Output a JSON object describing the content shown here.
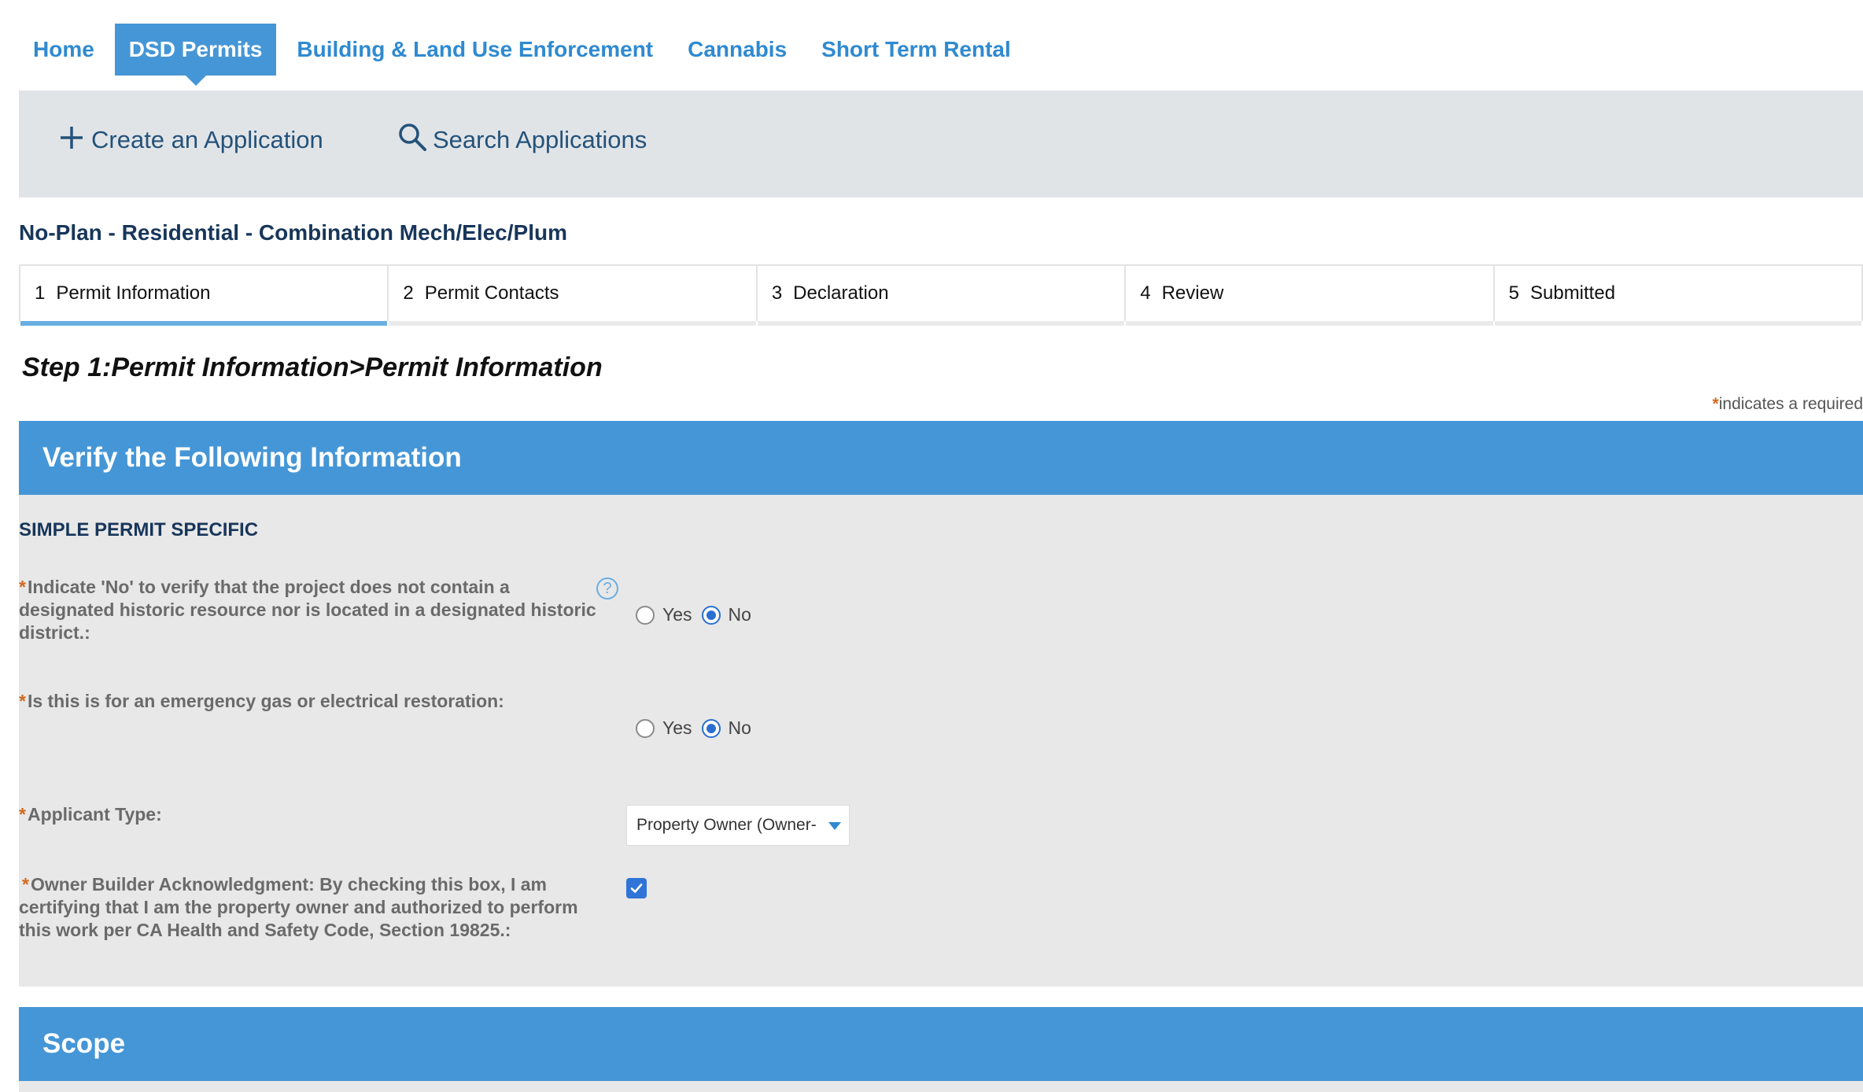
{
  "nav": {
    "tabs": [
      {
        "label": "Home",
        "active": false
      },
      {
        "label": "DSD Permits",
        "active": true
      },
      {
        "label": "Building & Land Use Enforcement",
        "active": false
      },
      {
        "label": "Cannabis",
        "active": false
      },
      {
        "label": "Short Term Rental",
        "active": false
      }
    ]
  },
  "actions": {
    "create": {
      "label": "Create an Application",
      "icon": "plus-icon"
    },
    "search": {
      "label": "Search Applications",
      "icon": "magnifier-icon"
    }
  },
  "record_type": "No-Plan - Residential - Combination Mech/Elec/Plum",
  "steps": [
    {
      "num": "1",
      "label": "Permit Information",
      "active": true
    },
    {
      "num": "2",
      "label": "Permit Contacts",
      "active": false
    },
    {
      "num": "3",
      "label": "Declaration",
      "active": false
    },
    {
      "num": "4",
      "label": "Review",
      "active": false
    },
    {
      "num": "5",
      "label": "Submitted",
      "active": false
    }
  ],
  "step_title": "Step 1:Permit Information>Permit Information",
  "required_note": {
    "star": "*",
    "text": "indicates a required"
  },
  "section_verify": {
    "title": "Verify the Following Information"
  },
  "subsection": "SIMPLE PERMIT SPECIFIC",
  "questions": {
    "historic": {
      "star": "*",
      "label": "Indicate 'No' to verify that the project does not contain a designated historic resource nor is located in a designated historic district.:",
      "yes_label": "Yes",
      "no_label": "No",
      "selected": "No",
      "help": "?"
    },
    "emergency": {
      "star": "*",
      "label": "Is this is for an emergency gas or electrical restoration:",
      "yes_label": "Yes",
      "no_label": "No",
      "selected": "No"
    },
    "applicant_type": {
      "star": "*",
      "label": "Applicant Type:",
      "value": "Property Owner (Owner-"
    },
    "owner_builder": {
      "star": "*",
      "label": "Owner Builder Acknowledgment: By checking this box, I am certifying that I am the property owner and authorized to perform this work per CA Health and Safety Code, Section 19825.:",
      "checked": true
    }
  },
  "section_scope": {
    "title": "Scope"
  },
  "colors": {
    "accent": "#4596d6",
    "link": "#2f8ad0",
    "panel": "#e8e8e8",
    "required": "#d2691e"
  }
}
